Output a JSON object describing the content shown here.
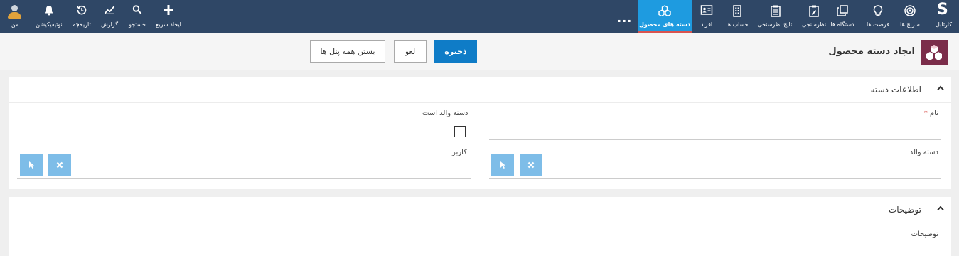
{
  "nav": {
    "brand": "S",
    "items": [
      {
        "id": "cartable",
        "label": "کارتابل",
        "icon": "brand-s-icon"
      },
      {
        "id": "funnel",
        "label": "سرنخ ها",
        "icon": "target-icon"
      },
      {
        "id": "opportunities",
        "label": "فرصت ها",
        "icon": "lightbulb-icon"
      },
      {
        "id": "devices",
        "label": "دستگاه ها",
        "icon": "copy-icon"
      },
      {
        "id": "survey",
        "label": "نظرسنجی",
        "icon": "edit-document-icon"
      },
      {
        "id": "survey_results",
        "label": "نتایج نظرسنجی",
        "icon": "clipboard-icon"
      },
      {
        "id": "accounts",
        "label": "حساب ها",
        "icon": "building-icon"
      },
      {
        "id": "people",
        "label": "افراد",
        "icon": "contact-card-icon"
      },
      {
        "id": "product_categories",
        "label": "دسته های محصول",
        "icon": "cubes-icon"
      }
    ],
    "more": "...",
    "tools": [
      {
        "id": "quick_create",
        "label": "ایجاد سریع",
        "icon": "plus-icon"
      },
      {
        "id": "search",
        "label": "جستجو",
        "icon": "search-icon"
      },
      {
        "id": "report",
        "label": "گزارش",
        "icon": "chart-icon"
      },
      {
        "id": "history",
        "label": "تاریخچه",
        "icon": "history-icon"
      },
      {
        "id": "notifications",
        "label": "نوتیفیکیشن",
        "icon": "bell-icon"
      },
      {
        "id": "me",
        "label": "من",
        "icon": "user-avatar-icon"
      }
    ]
  },
  "header": {
    "title": "ایجاد دسته محصول",
    "save": "ذخیره",
    "cancel": "لغو",
    "close_all": "بستن همه پنل ها"
  },
  "panel_info": {
    "title": "اطلاعات دسته",
    "name_label": "نام",
    "required_mark": "*",
    "parent_label": "دسته والد",
    "is_parent_label": "دسته والد است",
    "user_label": "کاربر"
  },
  "panel_desc": {
    "title": "توضیحات",
    "desc_label": "توضیحات"
  }
}
